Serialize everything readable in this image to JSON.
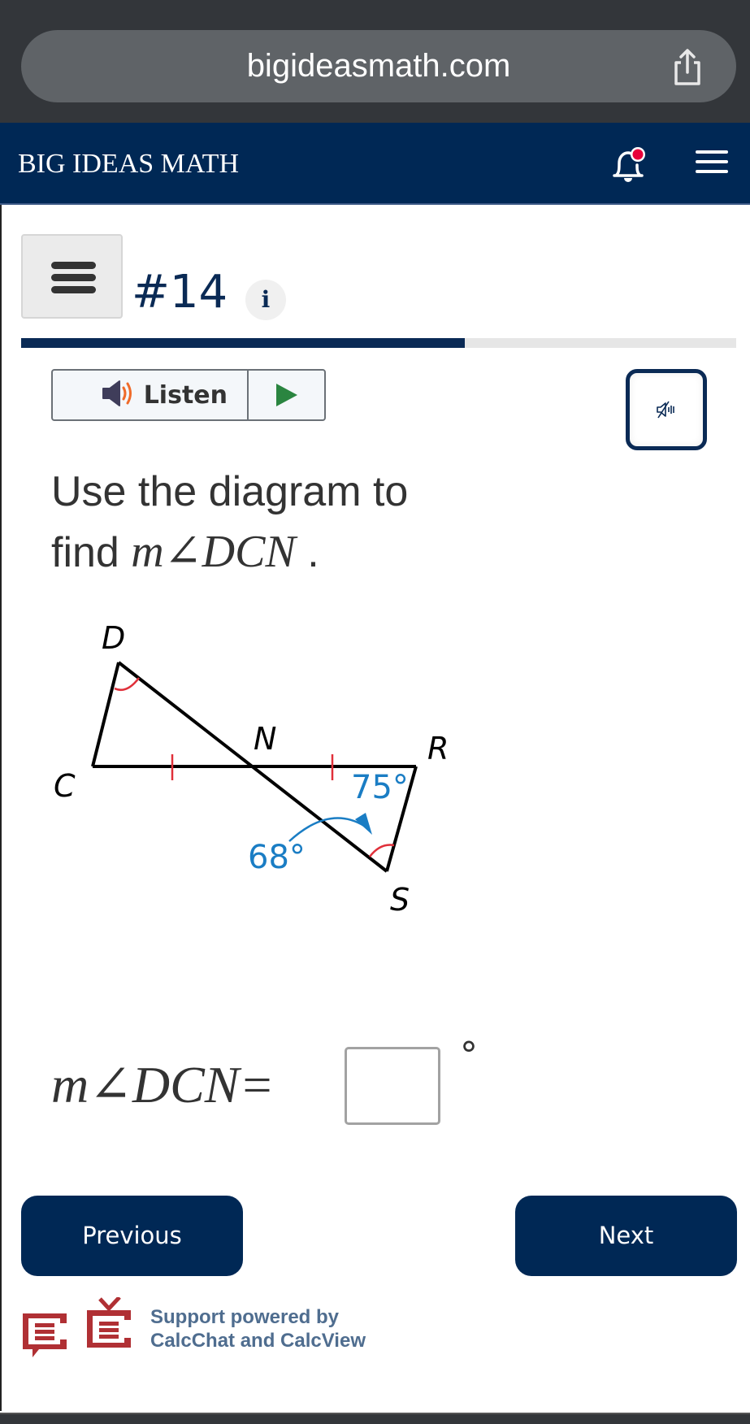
{
  "browser": {
    "url": "bigideasmath.com",
    "share_icon": "share-icon"
  },
  "header": {
    "brand": "BIG IDEAS MATH",
    "notification_icon": "bell-icon",
    "notification_dot_color": "#e8003a",
    "menu_icon": "hamburger-menu-icon",
    "background_color": "#002855"
  },
  "question_header": {
    "menu_icon": "hamburger-menu-icon",
    "number": "#14",
    "info_label": "i",
    "progress_percent": 62
  },
  "audio": {
    "listen_label": "Listen",
    "speaker_icon": "speaker-icon",
    "play_icon": "play-icon",
    "mute_icon": "mute-icon"
  },
  "question": {
    "line1": "Use the diagram to",
    "line2_prefix": "find ",
    "math": "m∠DCN",
    "line2_suffix": " ."
  },
  "diagram": {
    "points": {
      "D": "D",
      "C": "C",
      "N": "N",
      "R": "R",
      "S": "S"
    },
    "angle_label_1": "75°",
    "angle_label_2": "68°",
    "label_color": "#1a7dc4",
    "mark_color": "#e0303a"
  },
  "answer": {
    "expression": "m∠DCN",
    "equals": "=",
    "value": "",
    "unit": "°"
  },
  "navigation": {
    "previous_label": "Previous",
    "next_label": "Next"
  },
  "support": {
    "line1": "Support powered by",
    "line2": "CalcChat and CalcView",
    "calcchat_icon": "calcchat-icon",
    "calcview_icon": "calcview-icon"
  }
}
